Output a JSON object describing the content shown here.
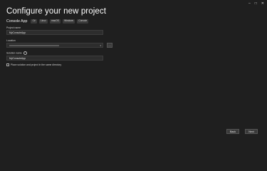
{
  "window": {
    "min": "–",
    "max": "□",
    "close": "✕"
  },
  "title": "Configure your new project",
  "template": {
    "name": "Console App",
    "tags": [
      "C#",
      "Linux",
      "macOS",
      "Windows",
      "Console"
    ]
  },
  "project_name": {
    "label": "Project name",
    "value": "MyConsoleApp"
  },
  "location": {
    "label": "Location",
    "value": "",
    "browse": "..."
  },
  "solution_name": {
    "label": "Solution name",
    "value": "MyConsoleApp",
    "info": "i"
  },
  "same_dir": {
    "label": "Place solution and project in the same directory"
  },
  "buttons": {
    "back": "Back",
    "next": "Next"
  }
}
